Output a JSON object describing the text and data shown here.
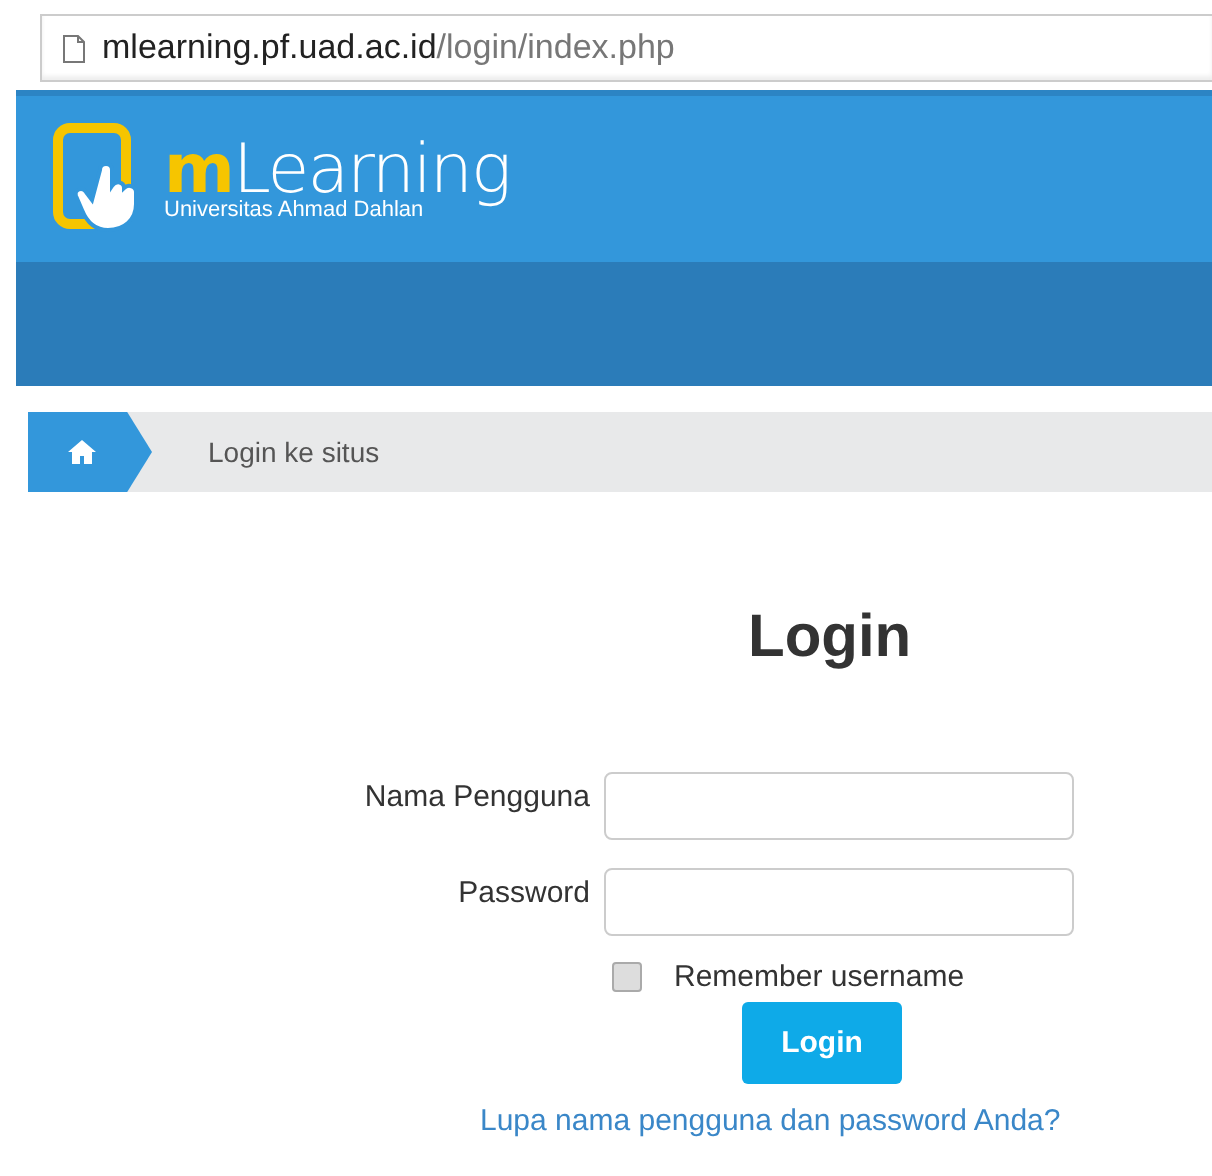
{
  "address_bar": {
    "host": "mlearning.pf.uad.ac.id",
    "path": "/login/index.php"
  },
  "header": {
    "logo_title": "mLearning",
    "logo_subtitle": "Universitas Ahmad Dahlan"
  },
  "breadcrumb": {
    "items": [
      "Login ke situs"
    ]
  },
  "login": {
    "title": "Login",
    "fields": [
      {
        "label": "Nama Pengguna"
      },
      {
        "label": "Password"
      }
    ],
    "remember": {
      "label": "Remember username",
      "checked": false
    },
    "button": "Login",
    "forgot_link": "Lupa nama pengguna dan password Anda?"
  }
}
